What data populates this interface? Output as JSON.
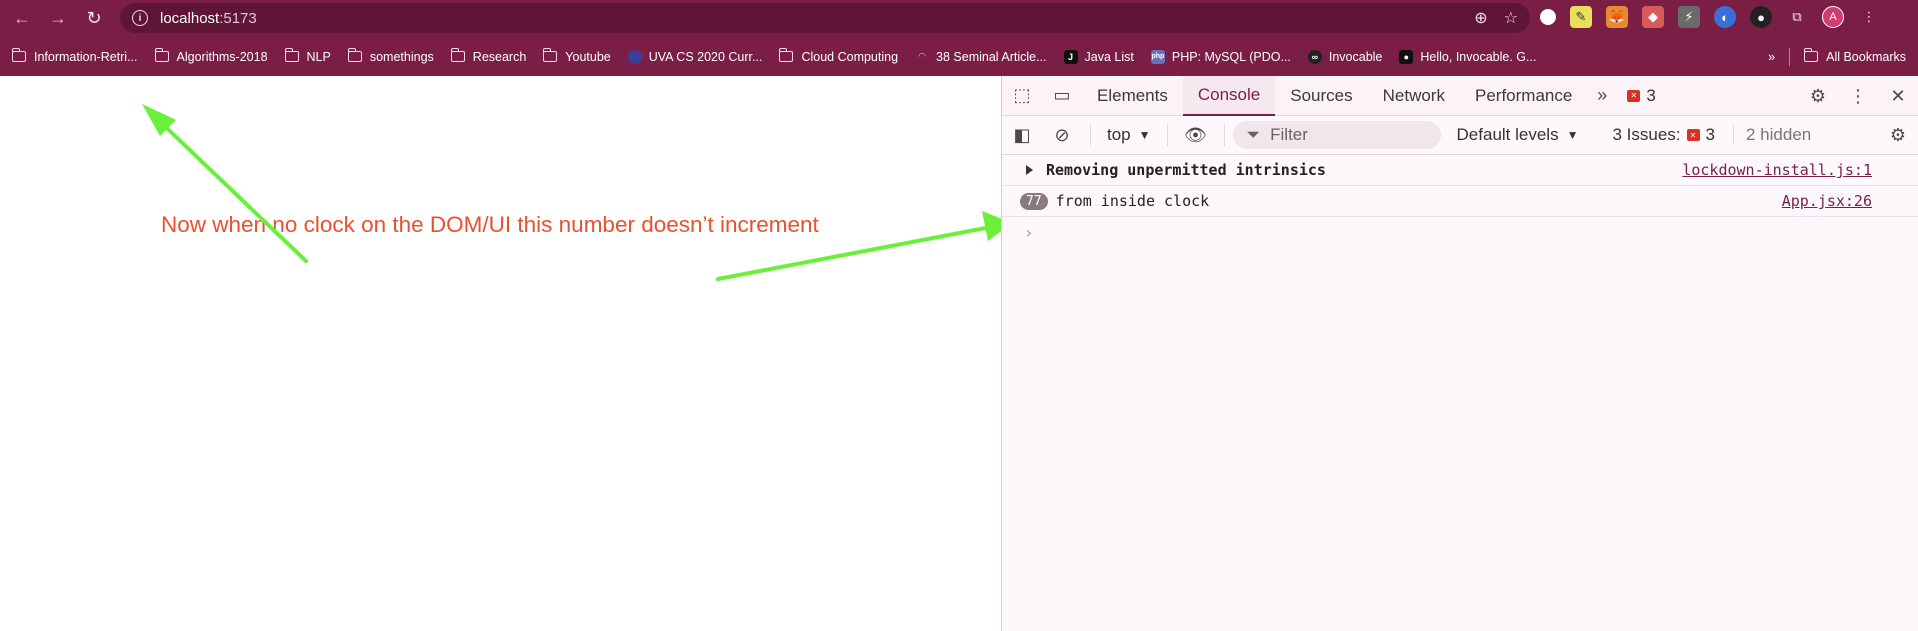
{
  "browser": {
    "url_host": "localhost",
    "url_port": ":5173"
  },
  "bookmarks": [
    {
      "label": "Information-Retri...",
      "kind": "folder"
    },
    {
      "label": "Algorithms-2018",
      "kind": "folder"
    },
    {
      "label": "NLP",
      "kind": "folder"
    },
    {
      "label": "somethings",
      "kind": "folder"
    },
    {
      "label": "Research",
      "kind": "folder"
    },
    {
      "label": "Youtube",
      "kind": "folder"
    },
    {
      "label": "UVA CS 2020 Curr...",
      "kind": "site"
    },
    {
      "label": "Cloud Computing",
      "kind": "folder"
    },
    {
      "label": "38 Seminal Article...",
      "kind": "site"
    },
    {
      "label": "Java List",
      "kind": "site"
    },
    {
      "label": "PHP: MySQL (PDO...",
      "kind": "site"
    },
    {
      "label": "Invocable",
      "kind": "site"
    },
    {
      "label": "Hello, Invocable. G...",
      "kind": "site"
    }
  ],
  "bookmarks_all": "All Bookmarks",
  "annotation": {
    "text": "Now when no clock on the DOM/UI this number doesn’t increment",
    "color": "#e8512f",
    "arrow_color": "#6af03a"
  },
  "devtools": {
    "tabs": [
      "Elements",
      "Console",
      "Sources",
      "Network",
      "Performance"
    ],
    "active_tab": "Console",
    "error_count": "3",
    "context": "top",
    "filter_placeholder": "Filter",
    "levels": "Default levels",
    "issues_label": "3 Issues:",
    "issues_count": "3",
    "hidden_label": "2 hidden",
    "logs": [
      {
        "message": "Removing unpermitted intrinsics",
        "source": "lockdown-install.js:1",
        "count": ""
      },
      {
        "message": "from inside clock",
        "source": "App.jsx:26",
        "count": "77"
      }
    ],
    "prompt": "›"
  }
}
